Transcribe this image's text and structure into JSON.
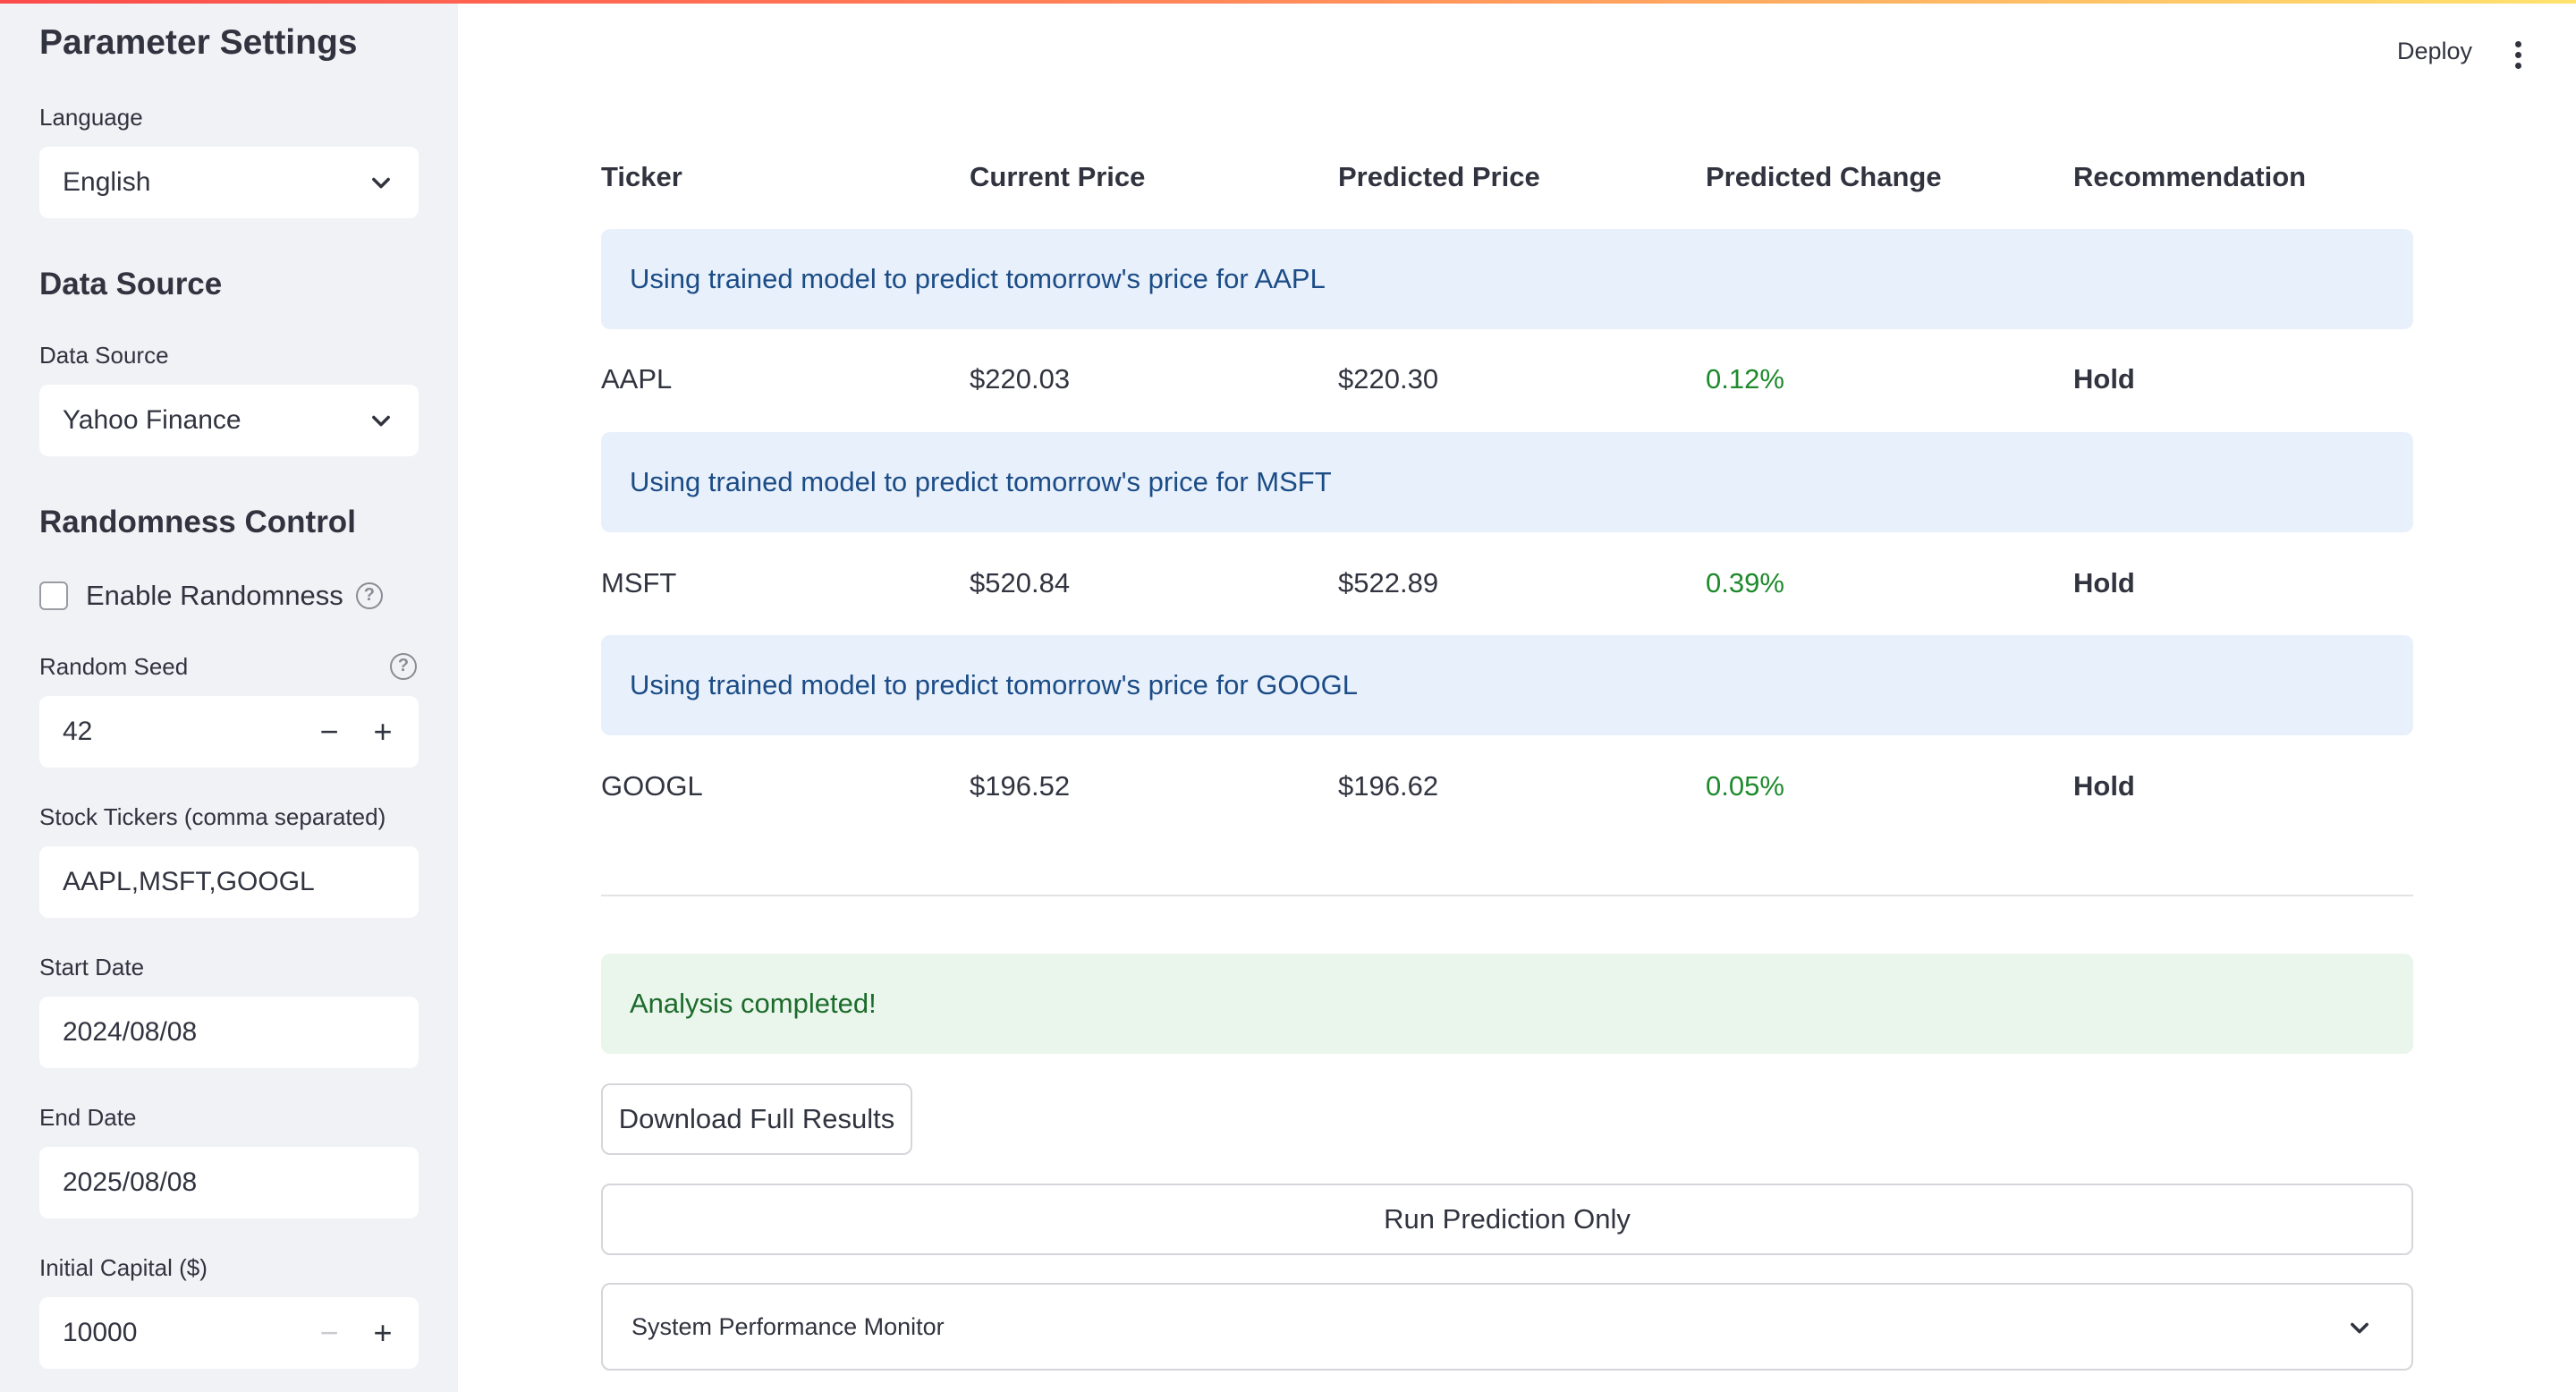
{
  "header": {
    "deploy_label": "Deploy"
  },
  "sidebar": {
    "title": "Parameter Settings",
    "language": {
      "label": "Language",
      "value": "English"
    },
    "data_source_heading": "Data Source",
    "data_source": {
      "label": "Data Source",
      "value": "Yahoo Finance"
    },
    "randomness_heading": "Randomness Control",
    "enable_randomness": {
      "label": "Enable Randomness",
      "checked": false
    },
    "random_seed": {
      "label": "Random Seed",
      "value": "42"
    },
    "tickers": {
      "label": "Stock Tickers (comma separated)",
      "value": "AAPL,MSFT,GOOGL"
    },
    "start_date": {
      "label": "Start Date",
      "value": "2024/08/08"
    },
    "end_date": {
      "label": "End Date",
      "value": "2025/08/08"
    },
    "initial_capital": {
      "label": "Initial Capital ($)",
      "value": "10000"
    }
  },
  "table": {
    "columns": [
      "Ticker",
      "Current Price",
      "Predicted Price",
      "Predicted Change",
      "Recommendation"
    ],
    "rows": [
      {
        "info": "Using trained model to predict tomorrow's price for AAPL",
        "ticker": "AAPL",
        "current": "$220.03",
        "predicted": "$220.30",
        "change": "0.12%",
        "recommendation": "Hold"
      },
      {
        "info": "Using trained model to predict tomorrow's price for MSFT",
        "ticker": "MSFT",
        "current": "$520.84",
        "predicted": "$522.89",
        "change": "0.39%",
        "recommendation": "Hold"
      },
      {
        "info": "Using trained model to predict tomorrow's price for GOOGL",
        "ticker": "GOOGL",
        "current": "$196.52",
        "predicted": "$196.62",
        "change": "0.05%",
        "recommendation": "Hold"
      }
    ]
  },
  "status": {
    "success_message": "Analysis completed!"
  },
  "actions": {
    "download_label": "Download Full Results",
    "run_prediction_label": "Run Prediction Only"
  },
  "expander": {
    "label": "System Performance Monitor"
  },
  "colors": {
    "accent": "#ff4b4b",
    "positive": "#1f8a2d",
    "info_bg": "#e8f0fb",
    "success_bg": "#eaf6ec"
  }
}
